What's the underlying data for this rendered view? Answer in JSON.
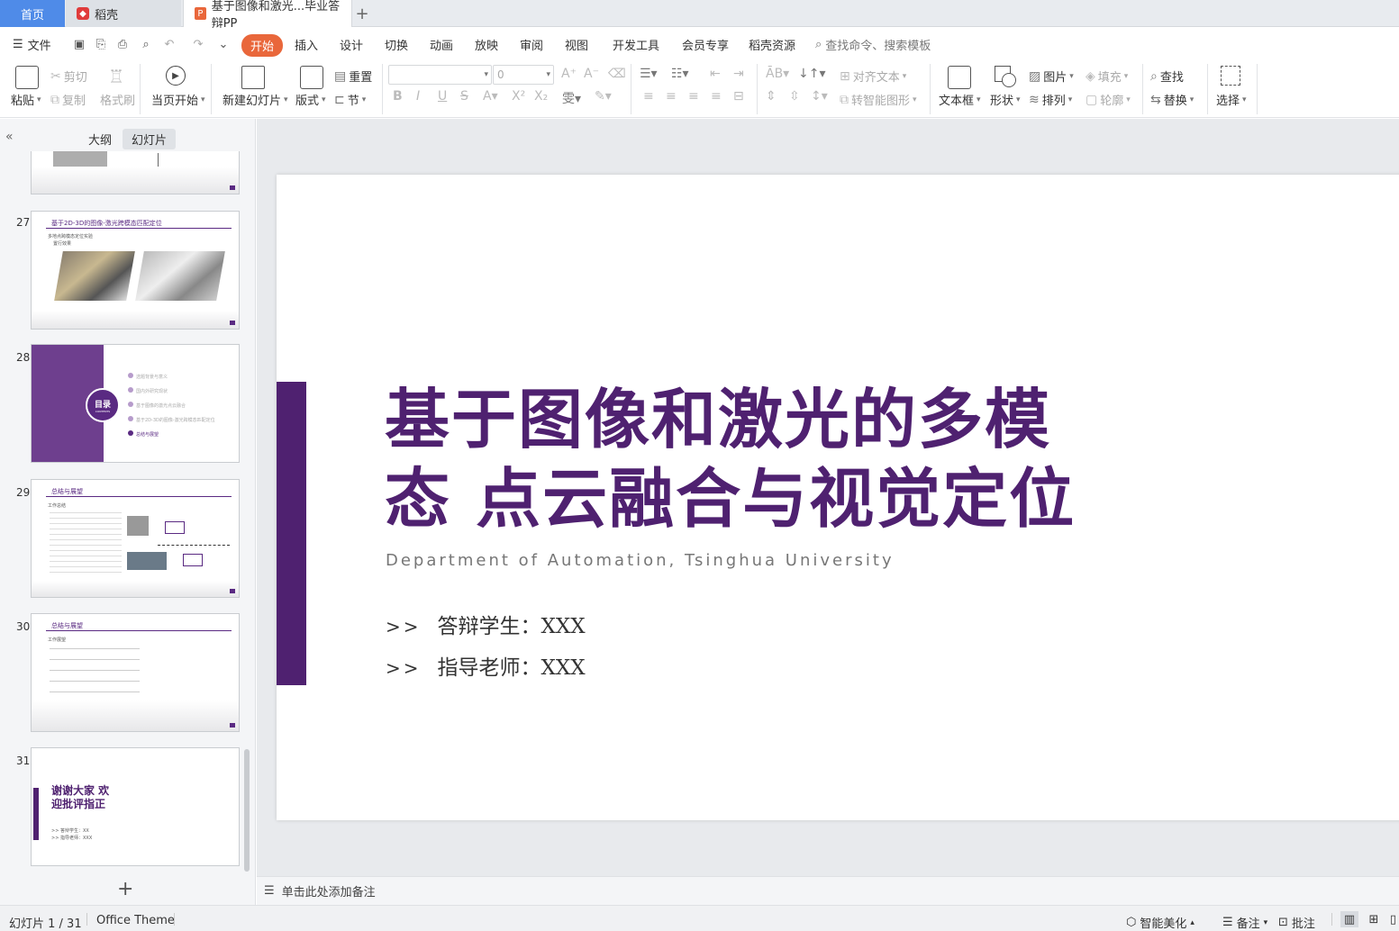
{
  "tabs": {
    "home": "首页",
    "doc": "稻壳",
    "file": "基于图像和激光...毕业答辩PP",
    "add": "+"
  },
  "menu": {
    "file": "文件",
    "items": [
      "开始",
      "插入",
      "设计",
      "切换",
      "动画",
      "放映",
      "审阅",
      "视图",
      "开发工具",
      "会员专享",
      "稻壳资源"
    ],
    "search_placeholder": "查找命令、搜索模板"
  },
  "ribbon": {
    "paste": "粘贴",
    "cut": "剪切",
    "copy": "复制",
    "format_painter": "格式刷",
    "play_current": "当页开始",
    "new_slide": "新建幻灯片",
    "layout": "版式",
    "reset": "重置",
    "section": "节",
    "font_size": "0",
    "align_text": "对齐文本",
    "convert_smartart": "转智能图形",
    "textbox": "文本框",
    "shape": "形状",
    "picture": "图片",
    "arrange": "排列",
    "fill": "填充",
    "outline": "轮廓",
    "find": "查找",
    "replace": "替换",
    "select": "选择"
  },
  "panel": {
    "outline_tab": "大纲",
    "slides_tab": "幻灯片",
    "thumbnails": [
      {
        "num": "27",
        "title": "基于2D-3D的图像-激光跨模态匹配定位",
        "bullets": [
          "多地点跨模态定位实验",
          "置行效果"
        ]
      },
      {
        "num": "28",
        "toc_label": "目录",
        "toc_sub": "CONTENTS",
        "items": [
          "选题背景与意义",
          "国内外研究现状",
          "基于图像的激光点云融合",
          "基于2D-3D的图像-激光跨模态匹配定位",
          "总结与展望"
        ]
      },
      {
        "num": "29",
        "title": "总结与展望",
        "bullets": [
          "工作总结"
        ]
      },
      {
        "num": "30",
        "title": "总结与展望",
        "bullets": [
          "工作展望"
        ]
      },
      {
        "num": "31",
        "title": "谢谢大家 欢迎批评指正",
        "info": [
          ">> 答辩学生：XX",
          ">> 指导老师：XXX"
        ]
      }
    ],
    "add": "+"
  },
  "slide": {
    "title": "基于图像和激光的多模态 点云融合与视觉定位",
    "subtitle": "Department of Automation, Tsinghua University",
    "student_arrow": ">>",
    "student": "答辩学生：XXX",
    "advisor_arrow": ">>",
    "advisor": "指导老师：XXX",
    "accent_color": "#4f2170"
  },
  "notes_placeholder": "单击此处添加备注",
  "status": {
    "slide_counter": "幻灯片 1 / 31",
    "theme": "Office Theme",
    "smart_beautify": "智能美化",
    "notes": "备注",
    "comments": "批注"
  }
}
